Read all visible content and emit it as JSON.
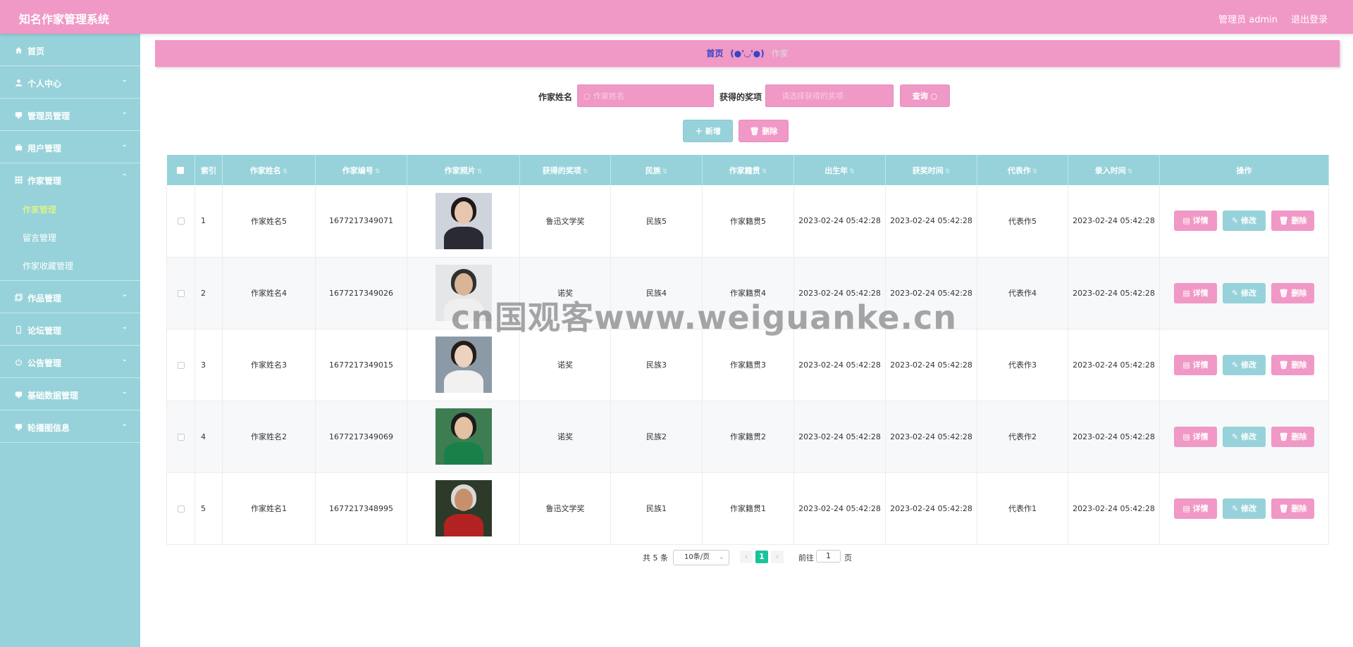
{
  "app": {
    "title": "知名作家管理系统",
    "user": "管理员 admin",
    "logout": "退出登录"
  },
  "sidebar": {
    "items": [
      {
        "label": "首页",
        "icon": "home-icon"
      },
      {
        "label": "个人中心",
        "icon": "person-icon"
      },
      {
        "label": "管理员管理",
        "icon": "monitor-icon"
      },
      {
        "label": "用户管理",
        "icon": "briefcase-icon"
      },
      {
        "label": "作家管理",
        "icon": "grid-icon"
      },
      {
        "label": "作品管理",
        "icon": "copy-icon"
      },
      {
        "label": "论坛管理",
        "icon": "phone-icon"
      },
      {
        "label": "公告管理",
        "icon": "power-icon"
      },
      {
        "label": "基础数据管理",
        "icon": "monitor-icon"
      },
      {
        "label": "轮播图信息",
        "icon": "monitor-icon"
      }
    ],
    "sub": [
      "作家管理",
      "留言管理",
      "作家收藏管理"
    ]
  },
  "breadcrumb": {
    "home": "首页",
    "sep": "(●'◡'●)",
    "current": "作家"
  },
  "search": {
    "name_label": "作家姓名",
    "name_placeholder": "作家姓名",
    "award_label": "获得的奖项",
    "award_placeholder": "请选择获得的奖项",
    "query_btn": "查询"
  },
  "actions": {
    "add": "新增",
    "delete": "删除"
  },
  "table": {
    "headers": [
      "索引",
      "作家姓名",
      "作家编号",
      "作家照片",
      "获得的奖项",
      "民族",
      "作家籍贯",
      "出生年",
      "获奖时间",
      "代表作",
      "录入时间",
      "操作"
    ],
    "rows": [
      {
        "idx": "1",
        "name": "作家姓名5",
        "code": "1677217349071",
        "award": "鲁迅文学奖",
        "nation": "民族5",
        "native": "作家籍贯5",
        "birth": "2023-02-24 05:42:28",
        "award_time": "2023-02-24 05:42:28",
        "work": "代表作5",
        "created": "2023-02-24 05:42:28"
      },
      {
        "idx": "2",
        "name": "作家姓名4",
        "code": "1677217349026",
        "award": "诺奖",
        "nation": "民族4",
        "native": "作家籍贯4",
        "birth": "2023-02-24 05:42:28",
        "award_time": "2023-02-24 05:42:28",
        "work": "代表作4",
        "created": "2023-02-24 05:42:28"
      },
      {
        "idx": "3",
        "name": "作家姓名3",
        "code": "1677217349015",
        "award": "诺奖",
        "nation": "民族3",
        "native": "作家籍贯3",
        "birth": "2023-02-24 05:42:28",
        "award_time": "2023-02-24 05:42:28",
        "work": "代表作3",
        "created": "2023-02-24 05:42:28"
      },
      {
        "idx": "4",
        "name": "作家姓名2",
        "code": "1677217349069",
        "award": "诺奖",
        "nation": "民族2",
        "native": "作家籍贯2",
        "birth": "2023-02-24 05:42:28",
        "award_time": "2023-02-24 05:42:28",
        "work": "代表作2",
        "created": "2023-02-24 05:42:28"
      },
      {
        "idx": "5",
        "name": "作家姓名1",
        "code": "1677217348995",
        "award": "鲁迅文学奖",
        "nation": "民族1",
        "native": "作家籍贯1",
        "birth": "2023-02-24 05:42:28",
        "award_time": "2023-02-24 05:42:28",
        "work": "代表作1",
        "created": "2023-02-24 05:42:28"
      }
    ],
    "row_actions": {
      "detail": "详情",
      "edit": "修改",
      "delete": "删除"
    }
  },
  "pager": {
    "total": "共 5 条",
    "size": "10条/页",
    "page": "1",
    "goto": "前往",
    "goto_value": "1",
    "unit": "页"
  },
  "watermark": "cn国观客www.weiguanke.cn",
  "colors": {
    "topbar": "#f098c6",
    "sidebar": "#97d2da",
    "active_sub": "#f4ff6a",
    "page_active": "#19c39b"
  }
}
